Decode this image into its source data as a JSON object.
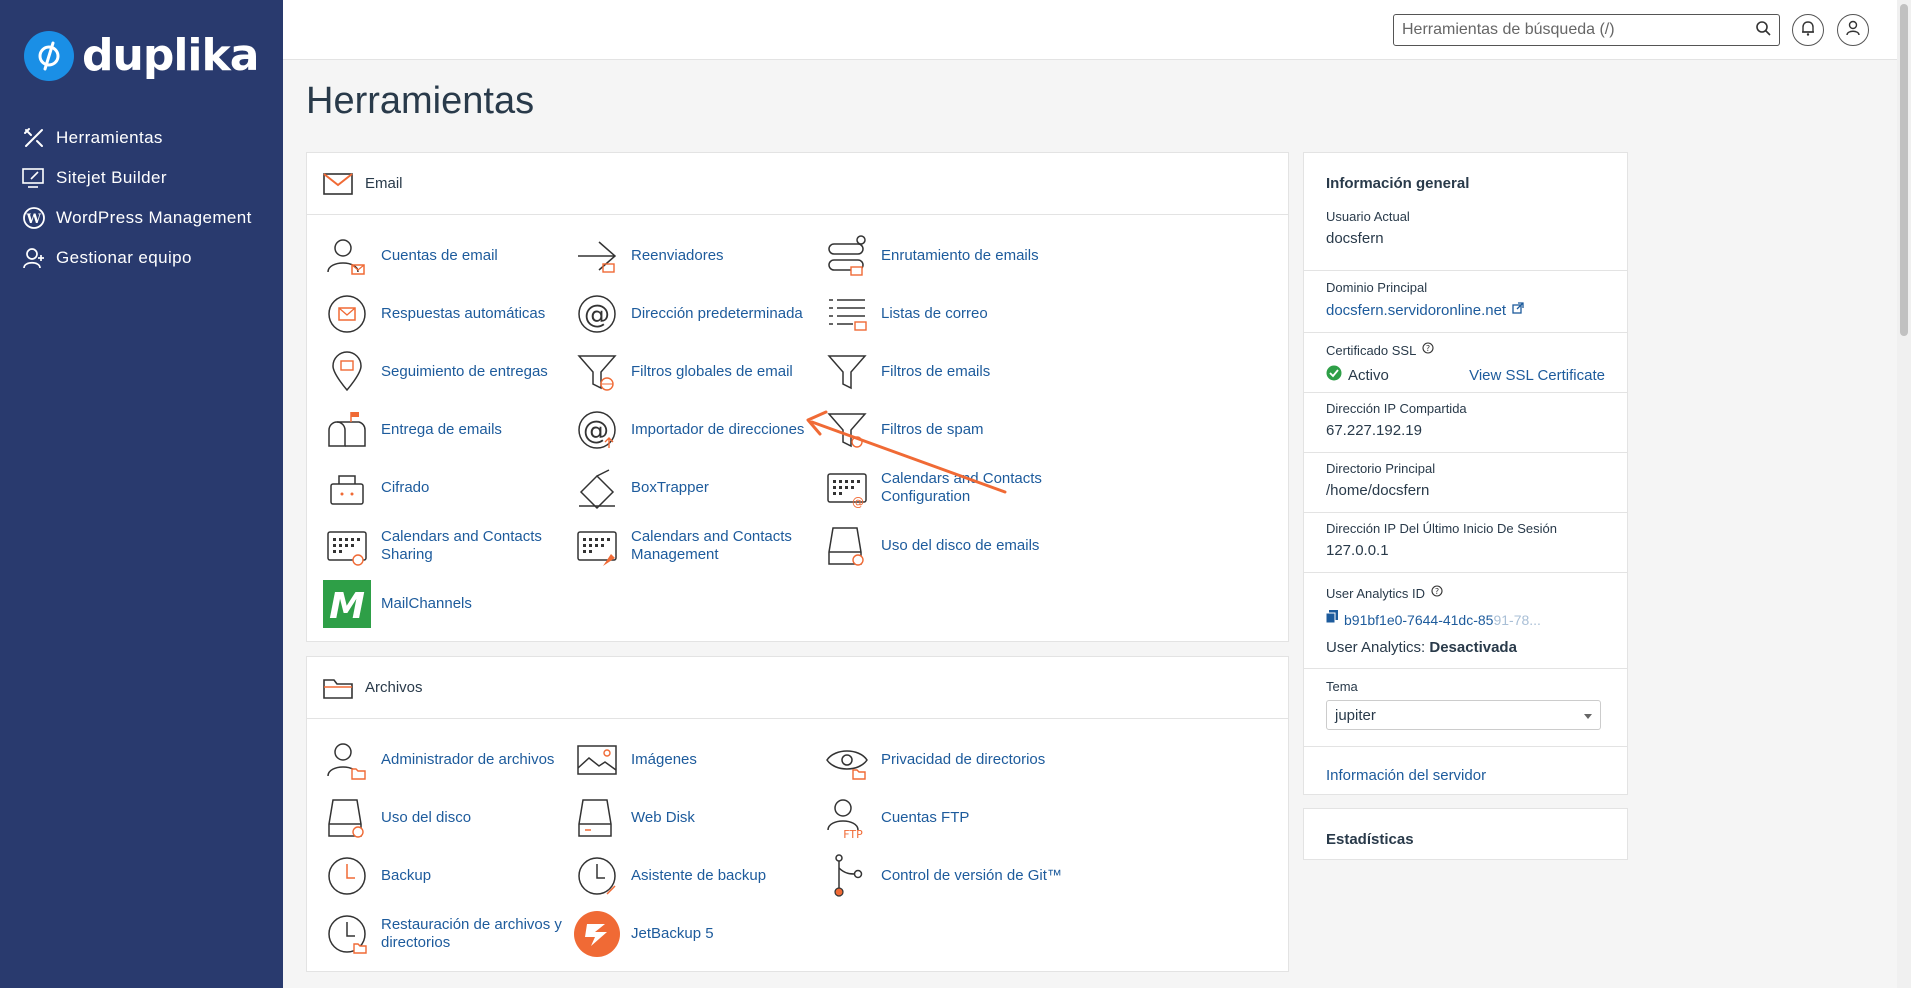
{
  "brand": {
    "name": "duplika",
    "accent": "#1a8fe6",
    "sidebar_bg": "#293a6e"
  },
  "sidebar": {
    "items": [
      {
        "label": "Herramientas",
        "icon": "tools-icon"
      },
      {
        "label": "Sitejet Builder",
        "icon": "monitor-pen-icon"
      },
      {
        "label": "WordPress Management",
        "icon": "wordpress-icon"
      },
      {
        "label": "Gestionar equipo",
        "icon": "user-plus-icon"
      }
    ]
  },
  "topbar": {
    "search_placeholder": "Herramientas de búsqueda (/)"
  },
  "page": {
    "title": "Herramientas"
  },
  "email_section": {
    "title": "Email",
    "tools": [
      "Cuentas de email",
      "Reenviadores",
      "Enrutamiento de emails",
      "Respuestas automáticas",
      "Dirección predeterminada",
      "Listas de correo",
      "Seguimiento de entregas",
      "Filtros globales de email",
      "Filtros de emails",
      "Entrega de emails",
      "Importador de direcciones",
      "Filtros de spam",
      "Cifrado",
      "BoxTrapper",
      "Calendars and Contacts Configuration",
      "Calendars and Contacts Sharing",
      "Calendars and Contacts Management",
      "Uso del disco de emails",
      "MailChannels"
    ]
  },
  "files_section": {
    "title": "Archivos",
    "tools": [
      "Administrador de archivos",
      "Imágenes",
      "Privacidad de directorios",
      "Uso del disco",
      "Web Disk",
      "Cuentas FTP",
      "Backup",
      "Asistente de backup",
      "Control de versión de Git™",
      "Restauración de archivos y directorios",
      "JetBackup 5"
    ]
  },
  "info": {
    "title": "Información general",
    "current_user_label": "Usuario Actual",
    "current_user": "docsfern",
    "domain_label": "Dominio Principal",
    "domain": "docsfern.servidoronline.net",
    "ssl_label": "Certificado SSL",
    "ssl_status": "Activo",
    "ssl_link": "View SSL Certificate",
    "shared_ip_label": "Dirección IP Compartida",
    "shared_ip": "67.227.192.19",
    "home_label": "Directorio Principal",
    "home": "/home/docsfern",
    "last_ip_label": "Dirección IP Del Último Inicio De Sesión",
    "last_ip": "127.0.0.1",
    "analytics_label": "User Analytics ID",
    "analytics_id": "b91bf1e0-7644-41dc-85",
    "analytics_id_faded": "91-78...",
    "analytics_status_label": "User Analytics:",
    "analytics_status": "Desactivada",
    "theme_label": "Tema",
    "theme": "jupiter",
    "server_info": "Información del servidor"
  },
  "stats": {
    "title": "Estadísticas"
  },
  "annotation": {
    "color": "#f06a35"
  }
}
